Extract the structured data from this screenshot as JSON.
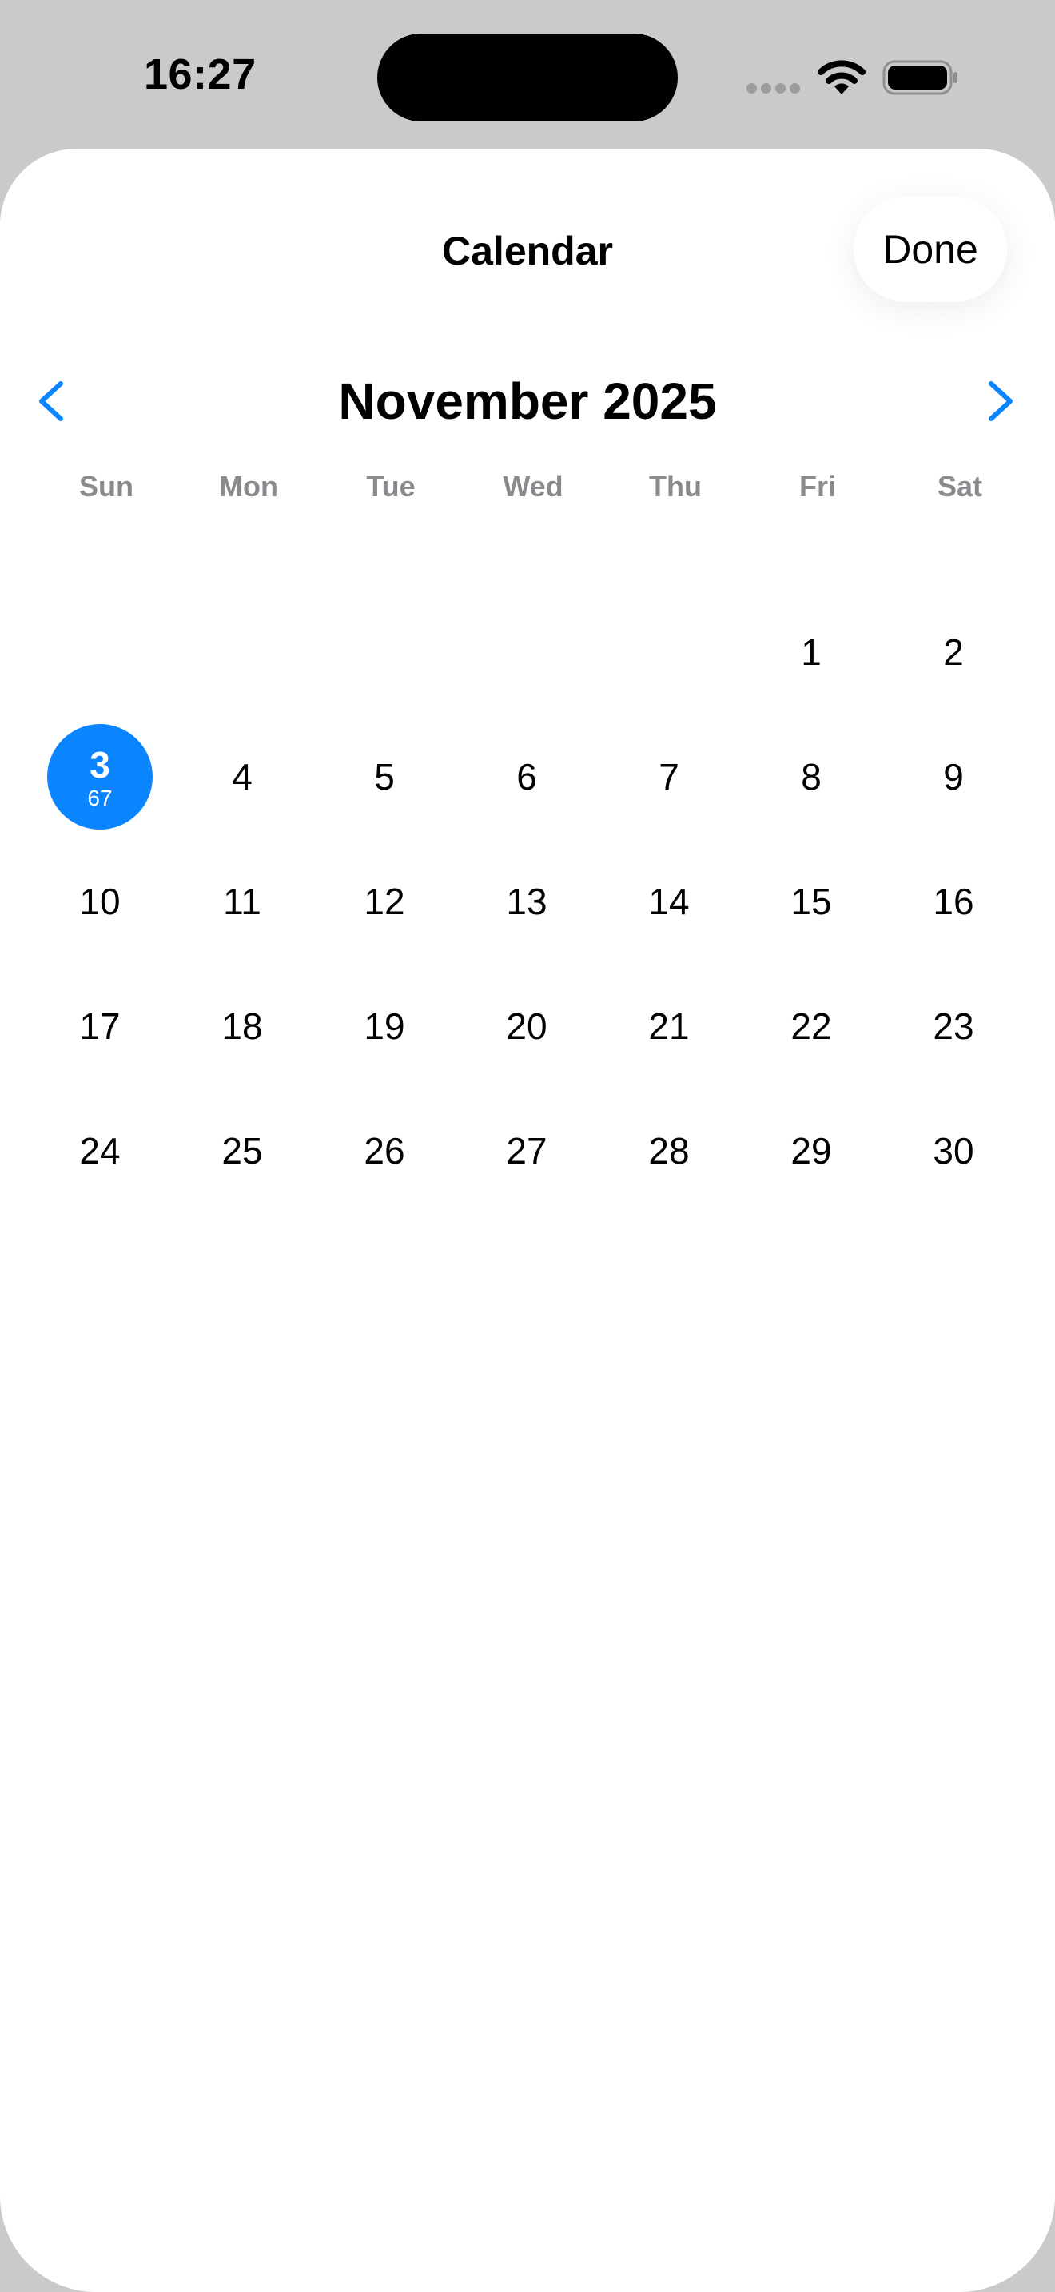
{
  "status_bar": {
    "time": "16:27"
  },
  "sheet": {
    "title": "Calendar",
    "done_label": "Done"
  },
  "calendar": {
    "month_label": "November 2025",
    "weekdays": [
      "Sun",
      "Mon",
      "Tue",
      "Wed",
      "Thu",
      "Fri",
      "Sat"
    ],
    "first_weekday_index": 5,
    "days_in_month": 30,
    "selected_day": 3,
    "selected_day_sub": "67",
    "accent_color": "#0a84ff"
  },
  "icons": {
    "prev": "chevron-left-icon",
    "next": "chevron-right-icon",
    "wifi": "wifi-icon",
    "battery": "battery-icon",
    "signal": "cellular-signal-icon"
  }
}
